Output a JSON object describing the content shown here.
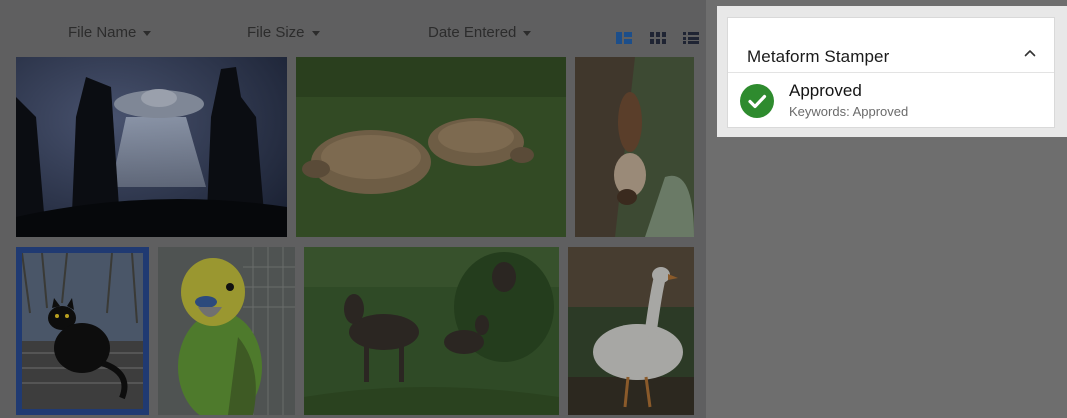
{
  "sort_options": [
    {
      "label": "File Name"
    },
    {
      "label": "File Size"
    },
    {
      "label": "Date Entered"
    }
  ],
  "view_modes": [
    "masonry-view-icon",
    "grid-view-icon",
    "list-view-icon"
  ],
  "thumbnails": [
    {
      "name": "ufo-abduction-thumbnail",
      "selected": false
    },
    {
      "name": "tortoises-thumbnail",
      "selected": false
    },
    {
      "name": "squirrel-thumbnail",
      "selected": false
    },
    {
      "name": "black-cat-thumbnail",
      "selected": true
    },
    {
      "name": "budgie-thumbnail",
      "selected": false
    },
    {
      "name": "moose-thumbnail",
      "selected": false
    },
    {
      "name": "goose-thumbnail",
      "selected": false
    }
  ],
  "stamper": {
    "title": "Metaform Stamper",
    "stamp": {
      "title": "Approved",
      "keywords": "Keywords: Approved",
      "color": "#2e8b2e"
    }
  },
  "colors": {
    "overlay": "#5f5f60",
    "selected_border": "#203a72",
    "active_view": "#1c4e8a"
  }
}
